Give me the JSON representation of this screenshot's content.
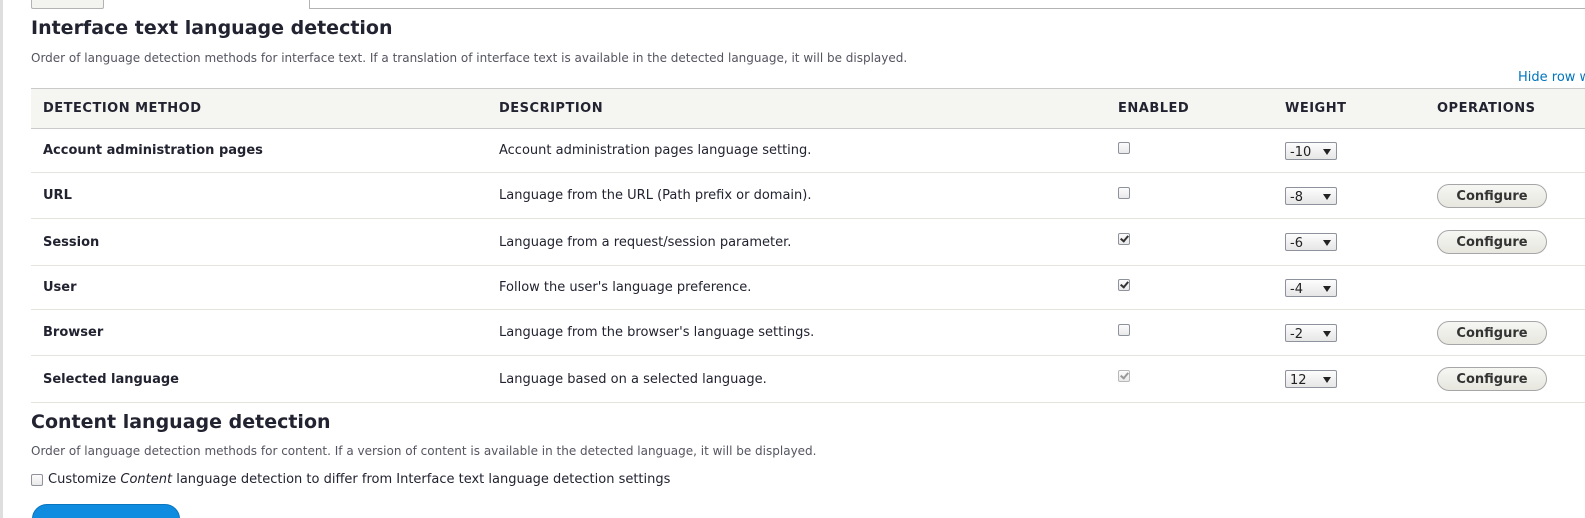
{
  "interface_section": {
    "title": "Interface text language detection",
    "description": "Order of language detection methods for interface text. If a translation of interface text is available in the detected language, it will be displayed.",
    "hide_link": "Hide row weights",
    "columns": {
      "method": "DETECTION METHOD",
      "description": "DESCRIPTION",
      "enabled": "ENABLED",
      "weight": "WEIGHT",
      "operations": "OPERATIONS"
    },
    "rows": [
      {
        "method": "Account administration pages",
        "description": "Account administration pages language setting.",
        "enabled": false,
        "disabled": false,
        "weight": "-10",
        "operation": ""
      },
      {
        "method": "URL",
        "description": "Language from the URL (Path prefix or domain).",
        "enabled": false,
        "disabled": false,
        "weight": "-8",
        "operation": "Configure"
      },
      {
        "method": "Session",
        "description": "Language from a request/session parameter.",
        "enabled": true,
        "disabled": false,
        "weight": "-6",
        "operation": "Configure"
      },
      {
        "method": "User",
        "description": "Follow the user's language preference.",
        "enabled": true,
        "disabled": false,
        "weight": "-4",
        "operation": ""
      },
      {
        "method": "Browser",
        "description": "Language from the browser's language settings.",
        "enabled": false,
        "disabled": false,
        "weight": "-2",
        "operation": "Configure"
      },
      {
        "method": "Selected language",
        "description": "Language based on a selected language.",
        "enabled": true,
        "disabled": true,
        "weight": "12",
        "operation": "Configure"
      }
    ]
  },
  "content_section": {
    "title": "Content language detection",
    "description": "Order of language detection methods for content. If a version of content is available in the detected language, it will be displayed.",
    "customize_prefix": "Customize ",
    "customize_emphasis": "Content",
    "customize_suffix": " language detection to differ from Interface text language detection settings",
    "customize_checked": false
  },
  "colors": {
    "link": "#0074bd",
    "primary_button": "#0f8ce0",
    "header_bg": "#f5f5f2"
  }
}
